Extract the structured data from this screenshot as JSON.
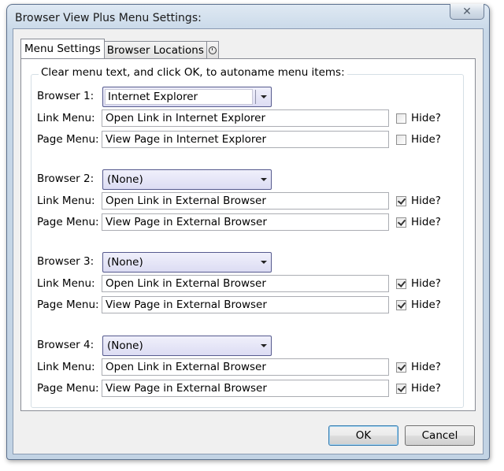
{
  "window": {
    "title": "Browser View Plus Menu Settings:"
  },
  "tabs": [
    {
      "label": "Menu Settings",
      "active": true
    },
    {
      "label": "Browser Locations",
      "active": false
    }
  ],
  "group_caption": "Clear menu text, and click OK, to autoname menu items:",
  "labels": {
    "link_menu": "Link Menu:",
    "page_menu": "Page Menu:",
    "hide": "Hide?"
  },
  "browsers": [
    {
      "label": "Browser 1:",
      "selected": "Internet Explorer",
      "link_menu": "Open Link in Internet Explorer",
      "page_menu": "View Page in Internet Explorer",
      "link_hidden": false,
      "page_hidden": false
    },
    {
      "label": "Browser 2:",
      "selected": "(None)",
      "link_menu": "Open Link in External Browser",
      "page_menu": "View Page in External Browser",
      "link_hidden": true,
      "page_hidden": true
    },
    {
      "label": "Browser 3:",
      "selected": "(None)",
      "link_menu": "Open Link in External Browser",
      "page_menu": "View Page in External Browser",
      "link_hidden": true,
      "page_hidden": true
    },
    {
      "label": "Browser 4:",
      "selected": "(None)",
      "link_menu": "Open Link in External Browser",
      "page_menu": "View Page in External Browser",
      "link_hidden": true,
      "page_hidden": true
    }
  ],
  "buttons": {
    "ok": "OK",
    "cancel": "Cancel"
  },
  "icons": {
    "close": "close-icon",
    "history_tab": "clock-icon"
  }
}
